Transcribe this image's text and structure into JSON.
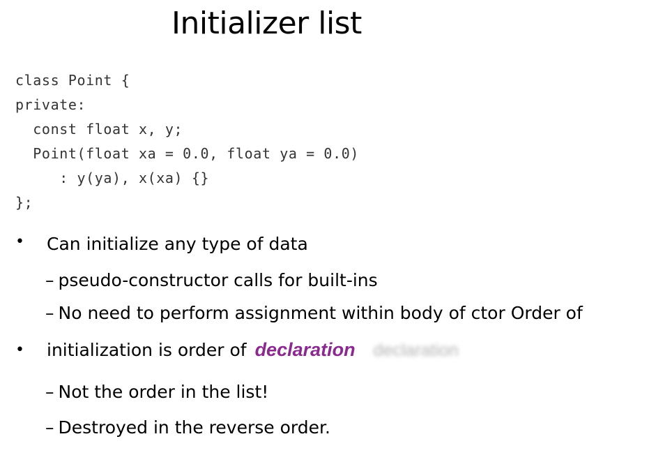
{
  "slide": {
    "title": "Initializer list"
  },
  "code": {
    "lines": [
      "class Point {",
      "private:",
      "  const float x, y;",
      "  Point(float xa = 0.0, float ya = 0.0)",
      "     : y(ya), x(xa) {}",
      "};"
    ]
  },
  "bullets": {
    "marker": "•",
    "dash": "–",
    "b1": {
      "text": "Can initialize any type of data",
      "sub1": "pseudo-constructor calls for built-ins",
      "sub2": "No need to perform assignment within body of ctor  Order of"
    },
    "b2": {
      "text": "initialization is order of",
      "emphasis": "declaration",
      "ghost": "declaration",
      "sub1": "Not the order in the list!",
      "sub2": "Destroyed in the reverse order."
    }
  },
  "colors": {
    "emphasis": "#8a2a8e",
    "code_text": "#333333",
    "background": "#ffffff"
  }
}
